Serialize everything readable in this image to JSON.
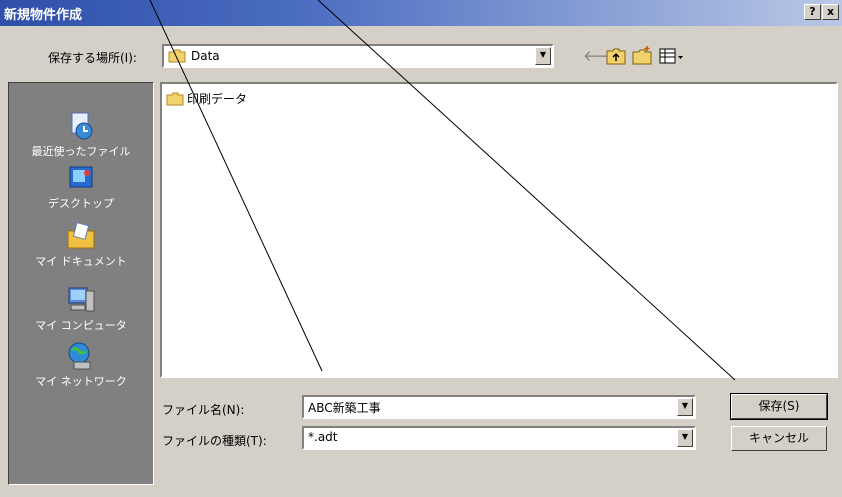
{
  "window": {
    "title": "新規物件作成",
    "help_label": "?",
    "close_label": "x"
  },
  "location": {
    "label": "保存する場所(I):",
    "value": "Data"
  },
  "toolbar": {
    "back_icon": "back-arrow-icon",
    "up_icon": "up-folder-icon",
    "new_folder_icon": "new-folder-icon",
    "view_icon": "view-menu-icon"
  },
  "places": [
    {
      "label": "最近使ったファイル",
      "icon": "recent-files-icon"
    },
    {
      "label": "デスクトップ",
      "icon": "desktop-icon"
    },
    {
      "label": "マイ ドキュメント",
      "icon": "my-documents-icon"
    },
    {
      "label": "マイ コンピュータ",
      "icon": "my-computer-icon"
    },
    {
      "label": "マイ ネットワーク",
      "icon": "my-network-icon"
    }
  ],
  "files": [
    {
      "name": "印刷データ",
      "icon": "folder-icon"
    }
  ],
  "filename": {
    "label": "ファイル名(N):",
    "value": "ABC新築工事"
  },
  "filetype": {
    "label": "ファイルの種類(T):",
    "value": "*.adt"
  },
  "buttons": {
    "save": "保存(S)",
    "cancel": "キャンセル"
  },
  "colors": {
    "title_bar": "#2f4fa8",
    "dialog_face": "#d4d0c8",
    "places_bar": "#808080"
  }
}
